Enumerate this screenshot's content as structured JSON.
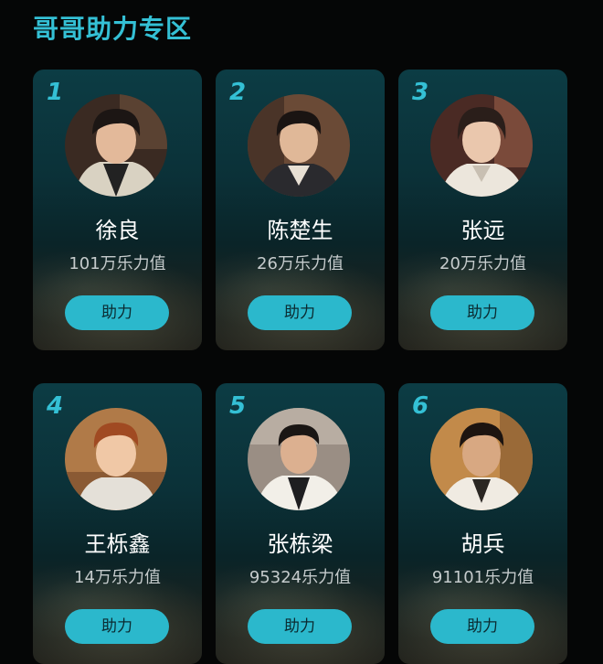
{
  "section_title": "哥哥助力专区",
  "boost_label": "助力",
  "colors": {
    "accent": "#34c0d5",
    "button": "#2bb8cc",
    "card_top": "#0c3c44",
    "page_bg": "#050606"
  },
  "artists": [
    {
      "rank": "1",
      "name": "徐良",
      "points": "101万乐力值"
    },
    {
      "rank": "2",
      "name": "陈楚生",
      "points": "26万乐力值"
    },
    {
      "rank": "3",
      "name": "张远",
      "points": "20万乐力值"
    },
    {
      "rank": "4",
      "name": "王栎鑫",
      "points": "14万乐力值"
    },
    {
      "rank": "5",
      "name": "张栋梁",
      "points": "95324乐力值"
    },
    {
      "rank": "6",
      "name": "胡兵",
      "points": "91101乐力值"
    }
  ]
}
